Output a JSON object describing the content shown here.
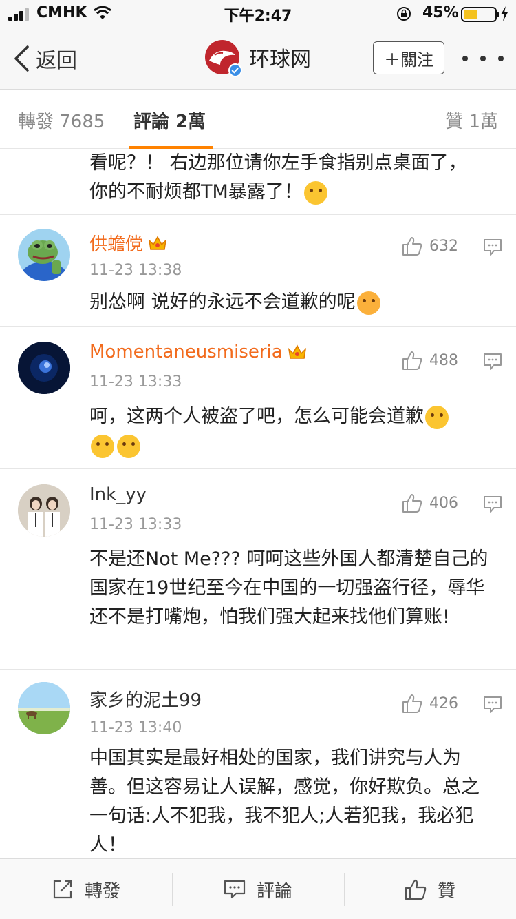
{
  "status_bar": {
    "carrier": "CMHK",
    "time": "下午2:47",
    "battery": "45%",
    "battery_level": 0.45
  },
  "nav": {
    "back_label": "返回",
    "account_name": "环球网",
    "follow_label": "＋關注"
  },
  "tabs": {
    "repost": "轉發 7685",
    "comments": "評論 2萬",
    "likes": "贊 1萬"
  },
  "partial_comment": {
    "text": "看呢？！ 右边那位请你左手食指别点桌面了，你的不耐烦都TM暴露了！"
  },
  "comments": [
    {
      "username": "供蟾傥",
      "time": "11-23 13:38",
      "likes": "632",
      "text": "别怂啊 说好的永远不会道歉的呢"
    },
    {
      "username": "Momentaneusmiseria",
      "time": "11-23 13:33",
      "likes": "488",
      "text": "呵，这两个人被盗了吧，怎么可能会道歉"
    },
    {
      "username": "Ink_yy",
      "time": "11-23 13:33",
      "likes": "406",
      "text": "不是还Not Me??? 呵呵这些外国人都清楚自己的国家在19世纪至今在中国的一切强盗行径，辱华还不是打嘴炮，怕我们强大起来找他们算账!"
    },
    {
      "username": "家乡的泥土99",
      "time": "11-23 13:40",
      "likes": "426",
      "text": "中国其实是最好相处的国家，我们讲究与人为善。但这容易让人误解，感觉，你好欺负。总之一句话:人不犯我，我不犯人;人若犯我，我必犯人！"
    }
  ],
  "toolbar": {
    "repost": "轉發",
    "comment": "評論",
    "like": "贊"
  },
  "colors": {
    "accent": "#ff8200",
    "vip_name": "#f26b1d",
    "brand_red": "#c0262d"
  }
}
